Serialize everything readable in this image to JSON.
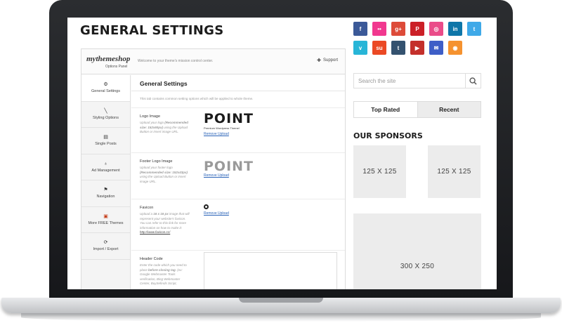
{
  "page": {
    "title": "GENERAL SETTINGS"
  },
  "options_panel": {
    "brand": "mythemeshop",
    "brand_sub": "Options Panel",
    "welcome": "Welcome to your theme's mission control center.",
    "support_label": "Support",
    "nav": [
      {
        "label": "General Settings",
        "icon": "gear-icon",
        "glyph": "⚙",
        "active": true
      },
      {
        "label": "Styling Options",
        "icon": "brush-icon",
        "glyph": "╲",
        "active": false
      },
      {
        "label": "Single Posts",
        "icon": "document-icon",
        "glyph": "▤",
        "active": false
      },
      {
        "label": "Ad Management",
        "icon": "money-bag-icon",
        "glyph": "♁",
        "active": false
      },
      {
        "label": "Navigation",
        "icon": "signpost-icon",
        "glyph": "⚑",
        "active": false
      },
      {
        "label": "More FREE Themes",
        "icon": "themes-icon",
        "glyph": "▣",
        "active": false
      },
      {
        "label": "Import / Export",
        "icon": "import-export-icon",
        "glyph": "⟳",
        "active": false
      }
    ],
    "content": {
      "title": "General Settings",
      "description": "This tab contains common setting options which will be applied to whole theme.",
      "logo_image": {
        "label": "Logo Image",
        "help_prefix": "Upload your logo ",
        "help_bold": "(Recommended size: 152x60px)",
        "help_suffix": " using the Upload Button or insert image URL.",
        "preview_text": "POINT",
        "preview_tagline": "Premium Wordpress Theme!",
        "remove_label": "Remove Upload"
      },
      "footer_logo": {
        "label": "Footer Logo Image",
        "help_prefix": "Upload your footer logo ",
        "help_bold": "(Recommended size: 152x43px)",
        "help_suffix": " using the Upload Button or insert image URL.",
        "preview_text": "POINT",
        "remove_label": "Remove Upload"
      },
      "favicon": {
        "label": "Favicon",
        "help_prefix": "Upload a ",
        "help_bold": "16 x 16 px",
        "help_suffix": " image that will represent your website's favicon. You can refer to this link for more information on how to make it: ",
        "help_link": "http://www.favicon.cc/",
        "remove_label": "Remove Upload"
      },
      "header_code": {
        "label": "Header Code",
        "help_prefix": "Enter the code which you need to place ",
        "help_bold": "before closing tag",
        "help_suffix": ". (ex: Google Webmaster Tools verification, Bing Webmaster Center, BuySellAds Script,"
      }
    }
  },
  "sidebar": {
    "social": [
      {
        "name": "facebook-icon",
        "glyph": "f",
        "color": "#3b5998"
      },
      {
        "name": "flickr-icon",
        "glyph": "••",
        "color": "#f1388f"
      },
      {
        "name": "google-plus-icon",
        "glyph": "g+",
        "color": "#dd4b39"
      },
      {
        "name": "pinterest-icon",
        "glyph": "P",
        "color": "#cb2027"
      },
      {
        "name": "dribbble-icon",
        "glyph": "◎",
        "color": "#ea4c89"
      },
      {
        "name": "linkedin-icon",
        "glyph": "in",
        "color": "#0e76a8"
      },
      {
        "name": "twitter-icon",
        "glyph": "t",
        "color": "#3fa9e8"
      },
      {
        "name": "vimeo-icon",
        "glyph": "v",
        "color": "#28b5d7"
      },
      {
        "name": "stumbleupon-icon",
        "glyph": "su",
        "color": "#eb4924"
      },
      {
        "name": "tumblr-icon",
        "glyph": "t",
        "color": "#34526f"
      },
      {
        "name": "youtube-icon",
        "glyph": "▶",
        "color": "#c4302b"
      },
      {
        "name": "email-icon",
        "glyph": "✉",
        "color": "#3e5ec7"
      },
      {
        "name": "rss-icon",
        "glyph": "◉",
        "color": "#f5922f"
      }
    ],
    "search_placeholder": "Search the site",
    "tabs": [
      "Top Rated",
      "Recent"
    ],
    "sponsors_title": "OUR SPONSORS",
    "ads": [
      "125 X 125",
      "125 X 125",
      "300 X 250"
    ]
  }
}
